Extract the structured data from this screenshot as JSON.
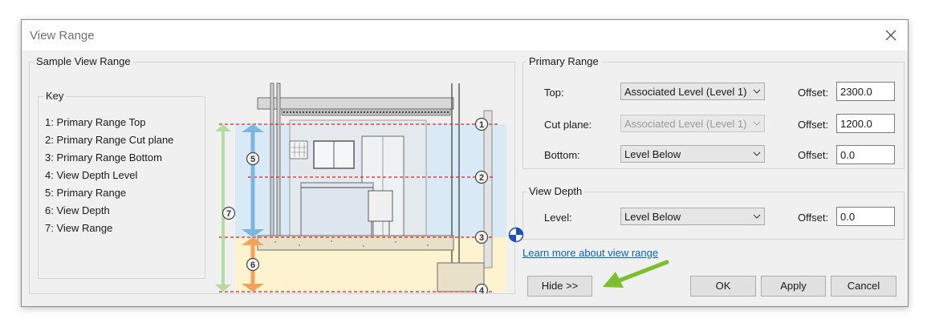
{
  "window": {
    "title": "View Range"
  },
  "sample": {
    "legend": "Sample View Range",
    "key": {
      "legend": "Key",
      "items": [
        "1: Primary Range Top",
        "2: Primary Range Cut plane",
        "3: Primary Range Bottom",
        "4: View Depth Level",
        "5: Primary Range",
        "6: View Depth",
        "7: View Range"
      ]
    },
    "markers": [
      "1",
      "2",
      "3",
      "4",
      "5",
      "6",
      "7"
    ]
  },
  "primary": {
    "legend": "Primary Range",
    "top": {
      "label": "Top:",
      "value": "Associated Level (Level 1)",
      "offset_label": "Offset:",
      "offset": "2300.0"
    },
    "cut": {
      "label": "Cut plane:",
      "value": "Associated Level (Level 1)",
      "offset_label": "Offset:",
      "offset": "1200.0"
    },
    "bottom": {
      "label": "Bottom:",
      "value": "Level Below",
      "offset_label": "Offset:",
      "offset": "0.0"
    }
  },
  "depth": {
    "legend": "View Depth",
    "level": {
      "label": "Level:",
      "value": "Level Below",
      "offset_label": "Offset:",
      "offset": "0.0"
    }
  },
  "link": "Learn more about view range",
  "buttons": {
    "hide": "Hide >>",
    "ok": "OK",
    "apply": "Apply",
    "cancel": "Cancel"
  },
  "colors": {
    "accent_red": "#d9262b",
    "primary_blue": "#7ab6e0",
    "depth_orange": "#f5a35c",
    "range_green": "#b5dca0",
    "arrow_green": "#7cbf2e",
    "link": "#0b63c1"
  }
}
